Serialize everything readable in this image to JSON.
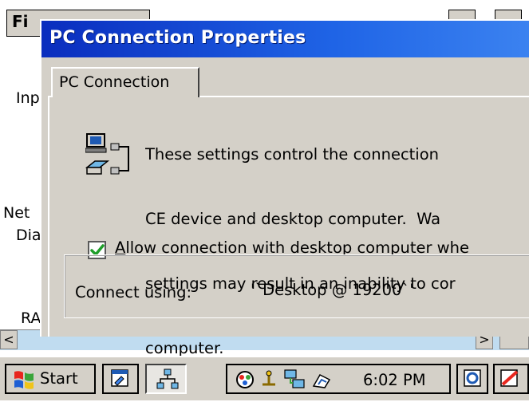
{
  "background_window": {
    "menu_label": "Fi",
    "labels": [
      "Inp",
      "Net",
      "Dia",
      "RA"
    ]
  },
  "dialog": {
    "title": "PC Connection Properties",
    "tab_label": "PC Connection",
    "description_lines": [
      "These settings control the connection",
      "CE device and desktop computer.  Wa",
      "settings may result in an inability to cor",
      "computer."
    ],
    "checkbox_label": "Allow connection with desktop computer whe",
    "checkbox_checked": true,
    "connect_label": "Connect using:",
    "connect_value": "'`Desktop @ 19200`'"
  },
  "taskbar": {
    "start_label": "Start",
    "clock": "6:02 PM"
  },
  "icons": {
    "start": "windows-flag-icon",
    "taskbar_app": "program-icon",
    "taskbar_network": "network-icon",
    "tray": [
      "mixer-icon",
      "usb-icon",
      "pc-connection-icon",
      "network-tray-icon"
    ],
    "desktop": "desktop-icon",
    "pen": "pen-icon"
  },
  "colors": {
    "titlebar_start": "#0a2dbe",
    "titlebar_end": "#3b82f0",
    "face": "#d4d0c8",
    "check": "#1f9e2a"
  }
}
